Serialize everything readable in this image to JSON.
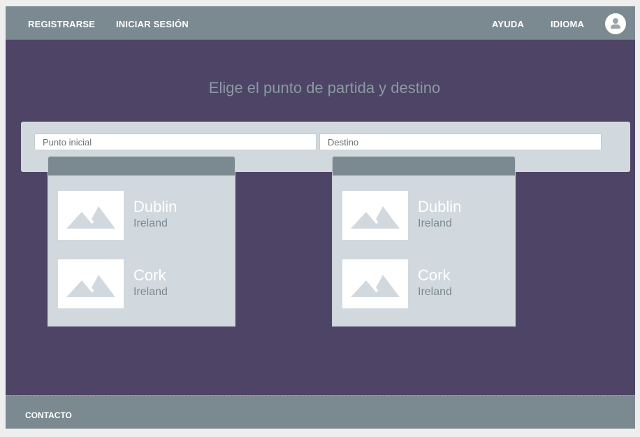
{
  "nav": {
    "register": "REGISTRARSE",
    "login": "INICIAR SESIÓN",
    "help": "AYUDA",
    "language": "IDIOMA"
  },
  "heading": "Elige el punto de partida y destino",
  "search": {
    "origin_placeholder": "Punto inicial",
    "destination_placeholder": "Destino"
  },
  "origin_results": [
    {
      "city": "Dublin",
      "country": "Ireland",
      "icon": "image-placeholder-icon"
    },
    {
      "city": "Cork",
      "country": "Ireland",
      "icon": "image-placeholder-icon"
    }
  ],
  "destination_results": [
    {
      "city": "Dublin",
      "country": "Ireland",
      "icon": "image-placeholder-icon"
    },
    {
      "city": "Cork",
      "country": "Ireland",
      "icon": "image-placeholder-icon"
    }
  ],
  "footer": {
    "contact": "CONTACTO"
  },
  "colors": {
    "page_bg": "#4e4466",
    "bar_bg": "#7a8a90",
    "panel_bg": "#d1d9de",
    "heading": "#8a9aa2"
  }
}
